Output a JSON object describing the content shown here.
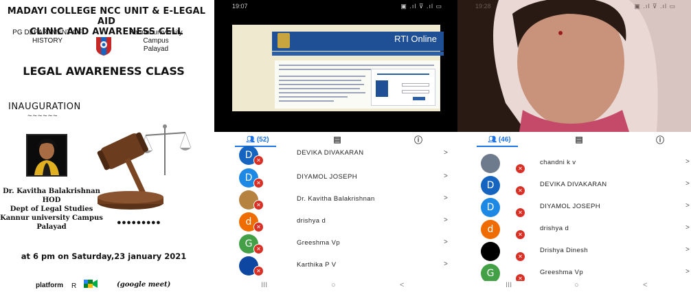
{
  "poster": {
    "title_line1": "MADAYI COLLEGE NCC UNIT &  E-LEGAL AID",
    "title_line2": "CLINIC AND AWARENESS CELL",
    "dept_line1": "PG DEPARTMENT OF",
    "dept_line2": "HISTORY",
    "campus_line1": "Kannur university Campus",
    "campus_line2": "Palayad",
    "class_title": "LEGAL AWARENESS CLASS",
    "inauguration": "INAUGURATION",
    "tilde": "~~~~~~",
    "speaker_name": "Dr. Kavitha Balakrishnan",
    "speaker_role": "HOD",
    "speaker_dept": "Dept of Legal Studies",
    "speaker_campus": "Kannur university Campus",
    "speaker_place": "Palayad",
    "dots": "●●●●●●●●●",
    "datetime": "at 6 pm on Saturday,23  january 2021",
    "platform_label": "platform",
    "platform_r": "R",
    "platform_name": "(google meet)"
  },
  "phone1": {
    "time": "19:07",
    "status_right": "▣ .ıl ⊽ .ıl ▭",
    "rti_title": "RTI Online",
    "tab_people_count": "(52)",
    "participants": [
      {
        "initial": "D",
        "name": "DEVIKA DIVAKARAN",
        "color": "#1565c0"
      },
      {
        "initial": "D",
        "name": "DIYAMOL JOSEPH",
        "color": "#1e88e5"
      },
      {
        "initial": "",
        "name": "Dr. Kavitha Balakrishnan",
        "color": "#b5823f"
      },
      {
        "initial": "d",
        "name": "drishya d",
        "color": "#ef6c00"
      },
      {
        "initial": "G",
        "name": "Greeshma Vp",
        "color": "#43a047"
      },
      {
        "initial": "",
        "name": "Karthika P V",
        "color": "#0d47a1"
      }
    ],
    "nav": [
      "III",
      "○",
      "<"
    ]
  },
  "phone2": {
    "time": "19:28",
    "status_right": "▣ .ıl ⊽ .ıl ▭",
    "tab_people_count": "(46)",
    "participants": [
      {
        "initial": "",
        "name": "chandni k v",
        "color": "#6d7b8c"
      },
      {
        "initial": "D",
        "name": "DEVIKA DIVAKARAN",
        "color": "#1565c0"
      },
      {
        "initial": "D",
        "name": "DIYAMOL JOSEPH",
        "color": "#1e88e5"
      },
      {
        "initial": "d",
        "name": "drishya d",
        "color": "#ef6c00"
      },
      {
        "initial": "",
        "name": "Drishya Dinesh",
        "color": "#000000"
      },
      {
        "initial": "G",
        "name": "Greeshma Vp",
        "color": "#43a047"
      }
    ],
    "nav": [
      "III",
      "○",
      "<"
    ]
  },
  "colors": {
    "accent": "#1a73e8",
    "mute": "#d93025",
    "rti_blue": "#1f4f94"
  }
}
